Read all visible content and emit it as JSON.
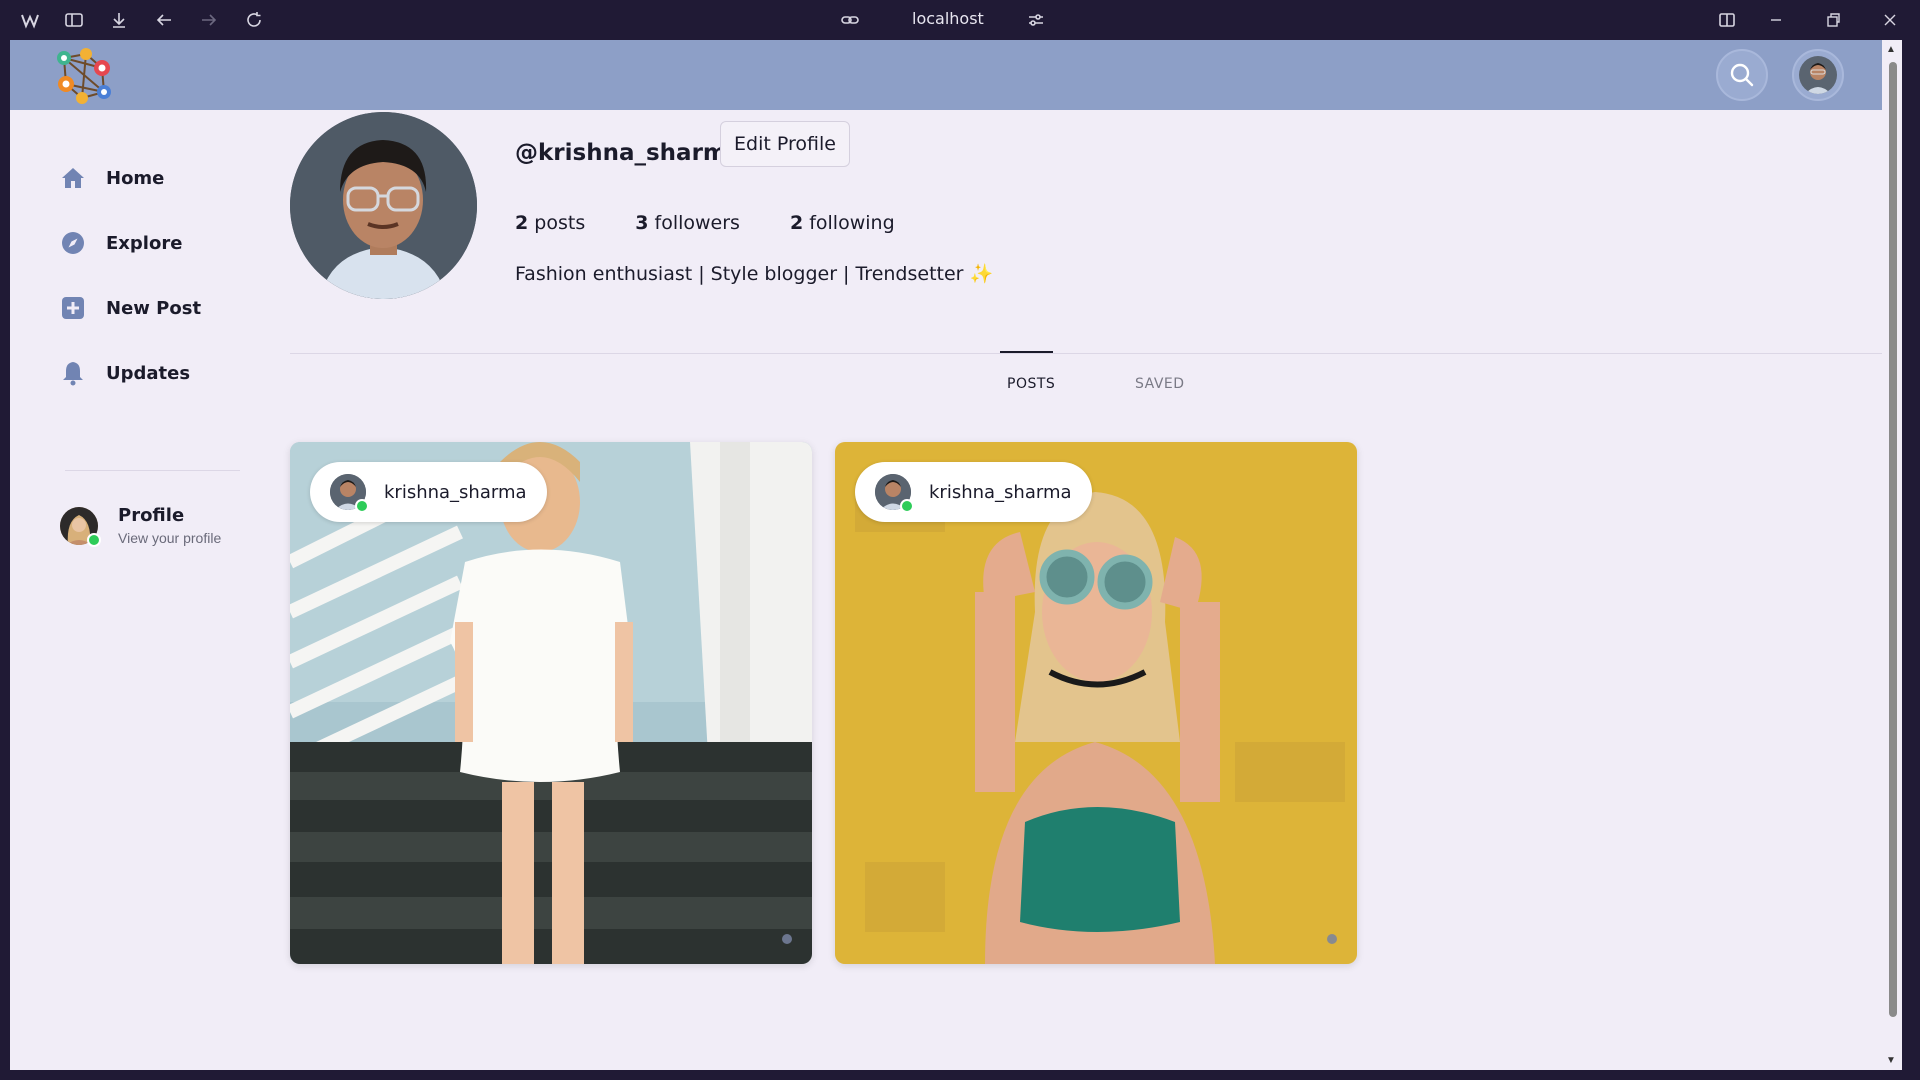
{
  "browser": {
    "url": "localhost",
    "icons": [
      "app-logo-icon",
      "sidebar-toggle-icon",
      "download-icon",
      "back-icon",
      "forward-icon",
      "reload-icon",
      "link-icon",
      "site-settings-icon",
      "split-view-icon",
      "minimize-icon",
      "restore-icon",
      "close-icon"
    ]
  },
  "nav": {
    "items": [
      {
        "label": "Home",
        "icon": "home-icon"
      },
      {
        "label": "Explore",
        "icon": "compass-icon"
      },
      {
        "label": "New Post",
        "icon": "plus-square-icon"
      },
      {
        "label": "Updates",
        "icon": "bell-icon"
      }
    ],
    "profile": {
      "title": "Profile",
      "subtitle": "View your profile"
    }
  },
  "profile": {
    "username": "@krishna_sharma",
    "edit_label": "Edit Profile",
    "posts_count": "2",
    "posts_label": "posts",
    "followers_count": "3",
    "followers_label": "followers",
    "following_count": "2",
    "following_label": "following",
    "bio": "Fashion enthusiast | Style blogger | Trendsetter ✨"
  },
  "tabs": [
    {
      "label": "POSTS",
      "active": true
    },
    {
      "label": "SAVED",
      "active": false
    }
  ],
  "posts": [
    {
      "author": "krishna_sharma",
      "photo": "woman in white off-shoulder dress on stairs"
    },
    {
      "author": "krishna_sharma",
      "photo": "woman with round sunglasses against yellow wall"
    }
  ],
  "colors": {
    "header": "#8d9fc7",
    "background": "#f1edf7",
    "accent_icon": "#7184b3",
    "online": "#2ecc59"
  }
}
